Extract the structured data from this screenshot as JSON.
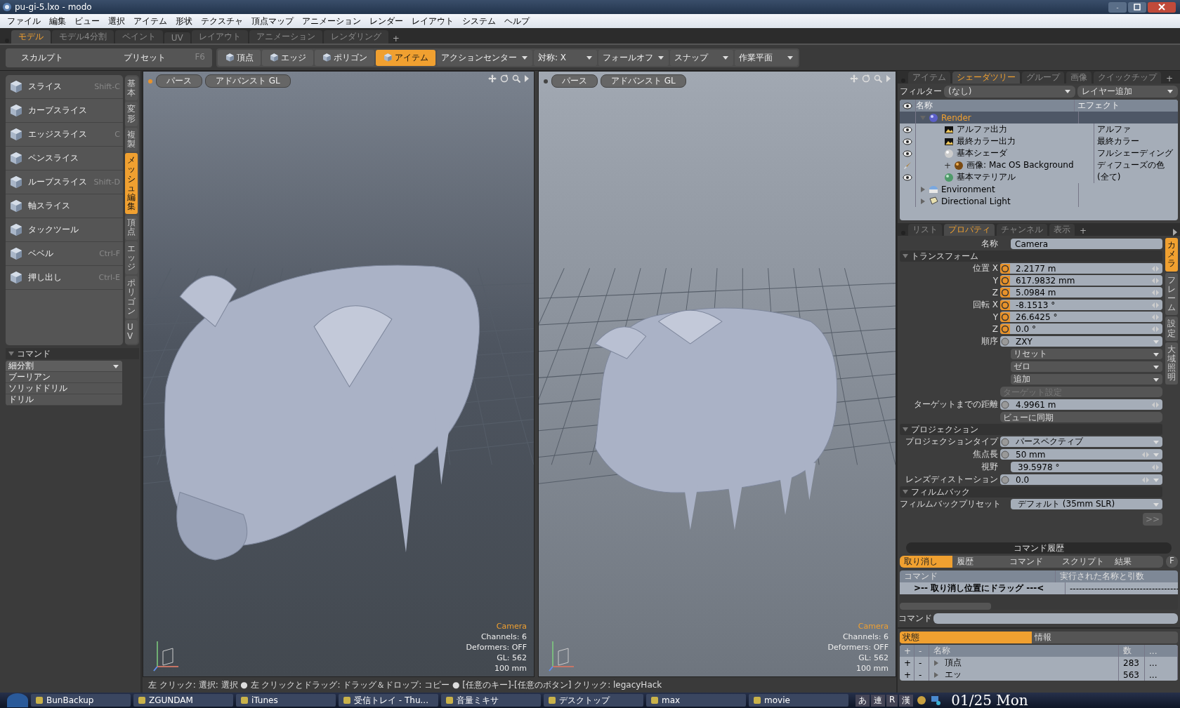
{
  "window": {
    "title": "pu-gi-5.lxo - modo"
  },
  "menu": [
    "ファイル",
    "編集",
    "ビュー",
    "選択",
    "アイテム",
    "形状",
    "テクスチャ",
    "頂点マップ",
    "アニメーション",
    "レンダー",
    "レイアウト",
    "システム",
    "ヘルプ"
  ],
  "mode_tabs": [
    {
      "label": "モデル",
      "selected": true
    },
    {
      "label": "モデル4分割",
      "selected": false
    },
    {
      "label": "ペイント",
      "selected": false
    },
    {
      "label": "UV",
      "selected": false
    },
    {
      "label": "レイアウト",
      "selected": false
    },
    {
      "label": "アニメーション",
      "selected": false
    },
    {
      "label": "レンダリング",
      "selected": false
    }
  ],
  "mode_add": "+",
  "toolbar": {
    "sculpt": "スカルプト",
    "preset": "プリセット",
    "preset_key": "F6",
    "select_modes": [
      {
        "label": "頂点",
        "selected": false
      },
      {
        "label": "エッジ",
        "selected": false
      },
      {
        "label": "ポリゴン",
        "selected": false
      },
      {
        "label": "アイテム",
        "selected": true
      }
    ],
    "dropdowns": [
      "アクションセンター",
      "対称: X",
      "フォールオフ",
      "スナップ",
      "作業平面"
    ]
  },
  "tools": [
    {
      "label": "スライス",
      "shortcut": "Shift-C"
    },
    {
      "label": "カーブスライス"
    },
    {
      "label": "エッジスライス",
      "shortcut": "C"
    },
    {
      "label": "ペンスライス"
    },
    {
      "label": "ループスライス",
      "shortcut": "Shift-D"
    },
    {
      "label": "軸スライス"
    },
    {
      "label": "タックツール"
    },
    {
      "label": "ベベル",
      "shortcut": "Ctrl-F"
    },
    {
      "label": "押し出し",
      "shortcut": "Ctrl-E"
    }
  ],
  "tool_tabs": [
    {
      "label": "基本",
      "selected": false
    },
    {
      "label": "変形",
      "selected": false
    },
    {
      "label": "複製",
      "selected": false
    },
    {
      "label": "メッシュ編集",
      "selected": true
    },
    {
      "label": "頂点",
      "selected": false
    },
    {
      "label": "エッジ",
      "selected": false
    },
    {
      "label": "ポリゴン",
      "selected": false
    },
    {
      "label": "UV",
      "selected": false
    }
  ],
  "commands": {
    "title": "コマンド",
    "expanded": true,
    "items": [
      {
        "label": "細分割",
        "kind": "dropdown"
      },
      {
        "label": "ブーリアン",
        "kind": "plain"
      },
      {
        "label": "ソリッドドリル",
        "kind": "plain"
      },
      {
        "label": "ドリル",
        "kind": "plain"
      }
    ]
  },
  "viewports": [
    {
      "tabs": [
        "パース",
        "アドバンスト GL"
      ],
      "camera": "Camera",
      "info": [
        "Channels: 6",
        "Deformers: OFF",
        "GL: 562",
        "100 mm"
      ]
    },
    {
      "tabs": [
        "パース",
        "アドバンスト GL"
      ],
      "camera": "Camera",
      "info": [
        "Channels: 6",
        "Deformers: OFF",
        "GL: 562",
        "100 mm"
      ]
    }
  ],
  "status_bar": "左 クリック: 選択: 選択 ● 左 クリックとドラッグ: ドラッグ＆ドロップ: コピー ● [任意のキー]-[任意のボタン] クリック: legacyHack",
  "shader_panel": {
    "tabs": [
      {
        "label": "アイテム",
        "selected": false
      },
      {
        "label": "シェーダツリー",
        "selected": true
      },
      {
        "label": "グループ",
        "selected": false
      },
      {
        "label": "画像",
        "selected": false
      },
      {
        "label": "クイックチップ",
        "selected": false
      }
    ],
    "add_tab": "+",
    "filter_label": "フィルター",
    "filter_value": "(なし)",
    "add_layer": "レイヤー追加",
    "columns": [
      "名称",
      "エフェクト"
    ],
    "nodes": [
      {
        "name": "Render",
        "kind": "render",
        "selected": true,
        "expanded": true,
        "children": [
          {
            "name": "アルファ出力",
            "kind": "output",
            "effect": "アルファ",
            "visibility": {
              "kind": "eye"
            },
            "selected": false
          },
          {
            "name": "最終カラー出力",
            "kind": "output",
            "effect": "最終カラー",
            "visibility": {
              "kind": "eye"
            },
            "selected": false
          },
          {
            "name": "基本シェーダ",
            "kind": "shader",
            "effect": "フルシェーディング",
            "visibility": {
              "kind": "eye"
            },
            "selected": false
          },
          {
            "name": "画像: Mac OS Background",
            "kind": "image",
            "toggle": "+",
            "effect": "ディフューズの色",
            "visibility": {
              "kind": "brush"
            },
            "selected": false
          },
          {
            "name": "基本マテリアル",
            "kind": "material",
            "effect": "(全て)",
            "visibility": {
              "kind": "eye"
            },
            "selected": false
          }
        ]
      },
      {
        "name": "Environment",
        "kind": "environment",
        "selected": false,
        "expanded": false
      },
      {
        "name": "Directional Light",
        "kind": "light",
        "selected": false,
        "expanded": false
      }
    ]
  },
  "properties": {
    "tabs": [
      {
        "label": "リスト",
        "selected": false
      },
      {
        "label": "プロパティ",
        "selected": true
      },
      {
        "label": "チャンネル",
        "selected": false
      },
      {
        "label": "表示",
        "selected": false
      }
    ],
    "add_tab": "+",
    "side_tabs": [
      {
        "label": "カメラ",
        "selected": true
      },
      {
        "label": "フレーム",
        "selected": false
      },
      {
        "label": "設定",
        "selected": false
      },
      {
        "label": "大域照明",
        "selected": false
      }
    ],
    "rows": [
      {
        "kind": "field",
        "label": "名称",
        "value": "Camera"
      },
      {
        "kind": "section",
        "label": "トランスフォーム",
        "expanded": true
      },
      {
        "kind": "vector",
        "label": "位置",
        "items": [
          {
            "axis": "X",
            "value": "2.2177 m",
            "animated": true
          },
          {
            "axis": "Y",
            "value": "617.9832 mm",
            "animated": true
          },
          {
            "axis": "Z",
            "value": "5.0984 m",
            "animated": true
          }
        ]
      },
      {
        "kind": "vector",
        "label": "回転",
        "items": [
          {
            "axis": "X",
            "value": "-8.1513 °",
            "animated": true
          },
          {
            "axis": "Y",
            "value": "26.6425 °",
            "animated": true
          },
          {
            "axis": "Z",
            "value": "0.0 °",
            "animated": true
          }
        ]
      },
      {
        "kind": "choice",
        "label": "順序",
        "value": "ZXY",
        "animated": false
      },
      {
        "kind": "menu",
        "value": "リセット"
      },
      {
        "kind": "menu",
        "value": "ゼロ"
      },
      {
        "kind": "menu",
        "value": "追加"
      },
      {
        "kind": "button",
        "label": "ターゲット設定",
        "disabled": true
      },
      {
        "kind": "number",
        "label": "ターゲットまでの距離",
        "value": "4.9961 m",
        "animated": false
      },
      {
        "kind": "button",
        "label": "ビューに同期",
        "disabled": false
      },
      {
        "kind": "section",
        "label": "プロジェクション",
        "expanded": true
      },
      {
        "kind": "choice",
        "label": "プロジェクションタイプ",
        "value": "パースペクティブ",
        "animated": false
      },
      {
        "kind": "number",
        "label": "焦点長",
        "value": "50 mm",
        "animated": false,
        "menu": true
      },
      {
        "kind": "number",
        "label": "視野",
        "value": "39.5978 °"
      },
      {
        "kind": "number",
        "label": "レンズディストーション",
        "value": "0.0",
        "animated": false,
        "menu": true
      },
      {
        "kind": "section",
        "label": "フィルムバック",
        "expanded": true
      },
      {
        "kind": "choice",
        "label": "フィルムバックプリセット",
        "value": "デフォルト (35mm SLR)"
      },
      {
        "kind": "more",
        "label": ">>"
      }
    ]
  },
  "command_history": {
    "title": "コマンド履歴",
    "tabs": [
      {
        "label": "取り消し",
        "selected": true
      },
      {
        "label": "履歴",
        "selected": false
      },
      {
        "label": "コマンド",
        "selected": false
      },
      {
        "label": "スクリプト",
        "selected": false
      },
      {
        "label": "結果",
        "selected": false
      }
    ],
    "filter_button": "F",
    "columns": [
      "コマンド",
      "実行された名称と引数"
    ],
    "rows": [
      [
        ">-- 取り消し位置にドラッグ ---<",
        "------------------------------------"
      ]
    ],
    "command_label": "コマンド"
  },
  "stats": {
    "tabs": [
      {
        "label": "状態",
        "selected": true
      },
      {
        "label": "情報",
        "selected": false
      }
    ],
    "columns": [
      "+",
      "-",
      "名称",
      "数",
      "..."
    ],
    "rows": [
      {
        "add": "+",
        "remove": "-",
        "name": "頂点",
        "count": "283",
        "more": "..."
      },
      {
        "add": "+",
        "remove": "-",
        "name": "エッ",
        "count": "563",
        "more": "..."
      }
    ]
  },
  "taskbar": {
    "apps": [
      "BunBackup",
      "ZGUNDAM",
      "iTunes",
      "受信トレイ - Thu...",
      "音量ミキサ",
      "デスクトップ",
      "max",
      "movie"
    ],
    "ime": [
      "あ",
      "連",
      "R",
      "漢"
    ],
    "clock": "01/25 Mon"
  }
}
